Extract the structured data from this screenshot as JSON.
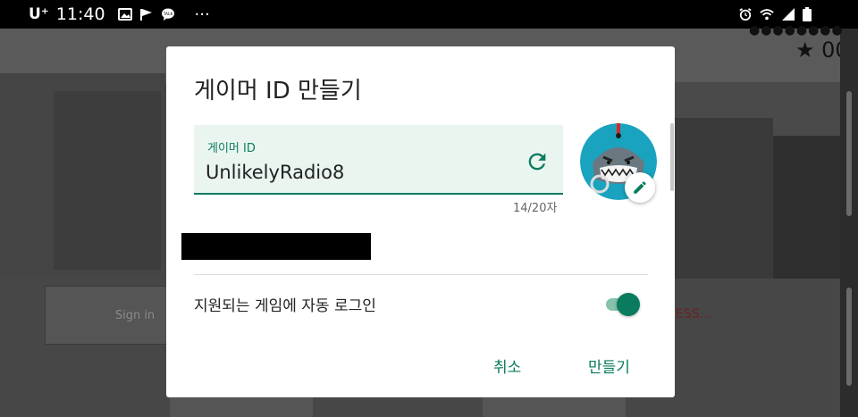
{
  "status_bar": {
    "carrier": "U⁺",
    "time": "11:40",
    "notification_icons": [
      "image-icon",
      "flag-icon",
      "talk-icon"
    ],
    "more": "···",
    "right_icons": [
      "alarm-icon",
      "wifi-icon",
      "signal-icon",
      "battery-icon"
    ]
  },
  "game": {
    "dots": "●●●●●●●●",
    "score": "★ 00",
    "signin_label": "Sign in",
    "press_text": "ESS..."
  },
  "dialog": {
    "title": "게이머 ID 만들기",
    "field": {
      "label": "게이머 ID",
      "value": "UnlikelyRadio8",
      "counter": "14/20자"
    },
    "auto_signin_label": "지원되는 게임에 자동 로그인",
    "auto_signin_enabled": true,
    "cancel_label": "취소",
    "create_label": "만들기",
    "accent_color": "#0a7b5e"
  }
}
